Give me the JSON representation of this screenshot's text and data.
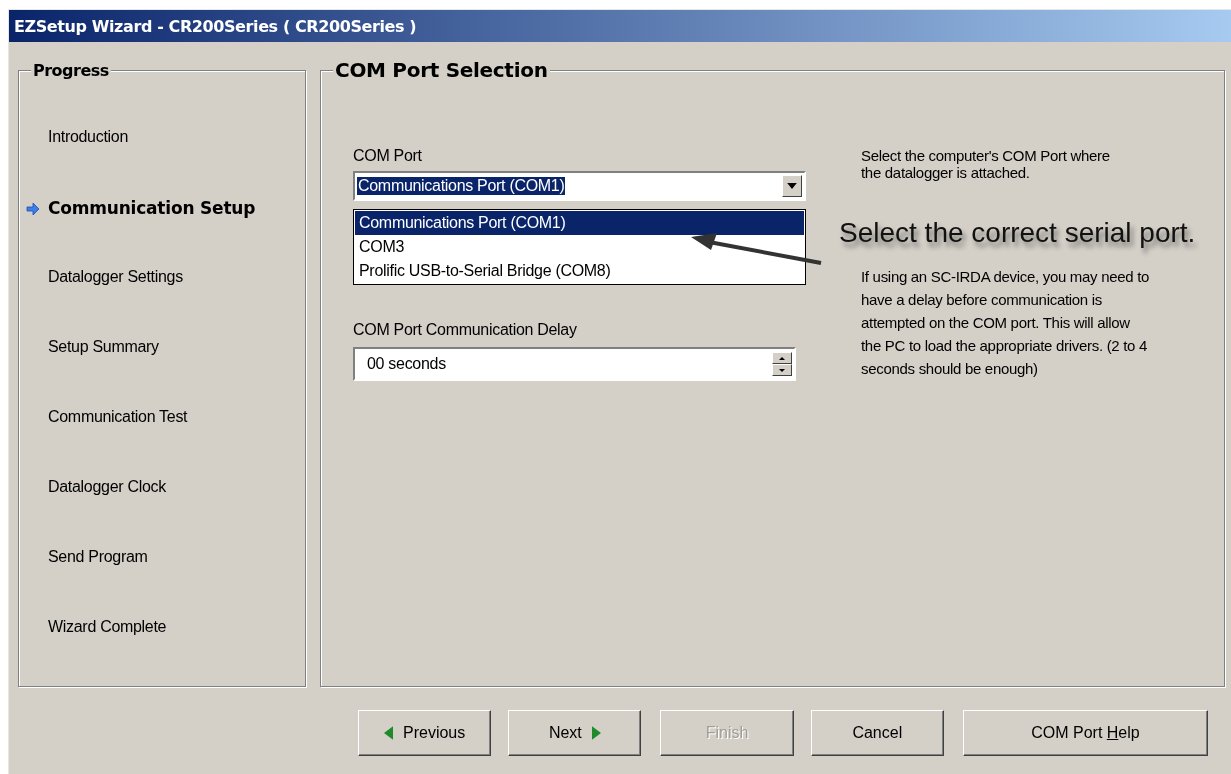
{
  "window": {
    "title": "EZSetup Wizard - CR200Series ( CR200Series )"
  },
  "progress": {
    "title": "Progress",
    "items": [
      {
        "label": "Introduction",
        "selected": false
      },
      {
        "label": "Communication Setup",
        "selected": true
      },
      {
        "label": "Datalogger Settings",
        "selected": false
      },
      {
        "label": "Setup Summary",
        "selected": false
      },
      {
        "label": "Communication Test",
        "selected": false
      },
      {
        "label": "Datalogger Clock",
        "selected": false
      },
      {
        "label": "Send Program",
        "selected": false
      },
      {
        "label": "Wizard Complete",
        "selected": false
      }
    ]
  },
  "panel": {
    "title": "COM Port Selection",
    "com_port": {
      "label": "COM Port",
      "value": "Communications Port (COM1)",
      "options": [
        {
          "label": "Communications Port (COM1)",
          "selected": true
        },
        {
          "label": "COM3",
          "selected": false
        },
        {
          "label": "Prolific USB-to-Serial Bridge (COM8)",
          "selected": false
        }
      ]
    },
    "delay": {
      "label": "COM Port Communication Delay",
      "value": "00 seconds"
    },
    "com_port_help_text": "Select the computer's COM Port where the datalogger is attached.",
    "callout": "Select the correct serial port.",
    "delay_help_text": "If using an SC-IRDA device, you may need to have a delay before communication is attempted on the COM port.  This will allow the PC to load the appropriate drivers. (2 to 4 seconds should be enough)"
  },
  "buttons": [
    {
      "kind": "previous",
      "label": "Previous",
      "disabled": false
    },
    {
      "kind": "next",
      "label": "Next",
      "disabled": false
    },
    {
      "kind": "plain",
      "label": "Finish",
      "disabled": true
    },
    {
      "kind": "plain",
      "label": "Cancel",
      "disabled": false
    },
    {
      "kind": "help",
      "label_before": "COM Port ",
      "mnemonic": "H",
      "label_after": "elp",
      "disabled": false
    }
  ]
}
